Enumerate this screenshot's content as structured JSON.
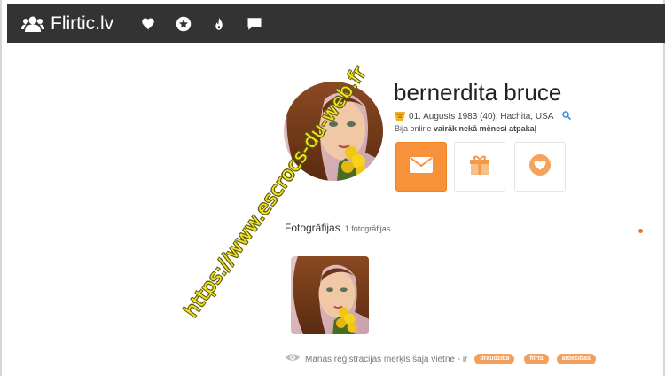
{
  "app": {
    "title": "Flirtic.lv"
  },
  "nav": [
    {
      "name": "favorites-heart-icon"
    },
    {
      "name": "star-icon"
    },
    {
      "name": "flame-icon"
    },
    {
      "name": "messages-icon"
    }
  ],
  "profile": {
    "name": "bernerdita bruce",
    "birth_location": "01. Augusts 1983 (40), Hachita, USA",
    "online_prefix": "Bija online ",
    "online_bold": "vairāk nekā mēnesi atpakaļ"
  },
  "actions": [
    {
      "name": "send-message-button",
      "icon": "envelope-icon"
    },
    {
      "name": "send-gift-button",
      "icon": "gift-icon"
    },
    {
      "name": "add-favorite-button",
      "icon": "heart-icon"
    }
  ],
  "photos": {
    "title": "Fotogrāfijas",
    "count": "1 fotogrāfijas"
  },
  "goal": {
    "text": "Manas reģistrācijas mērķis šajā vietnē - ir",
    "tags": [
      "draudzība",
      "flirts",
      "attiecības"
    ]
  },
  "watermark": "https://www.escrocs-du-web.fr",
  "colors": {
    "topbar": "#333333",
    "accent": "#f7923a",
    "watermark": "#f2e21c"
  }
}
